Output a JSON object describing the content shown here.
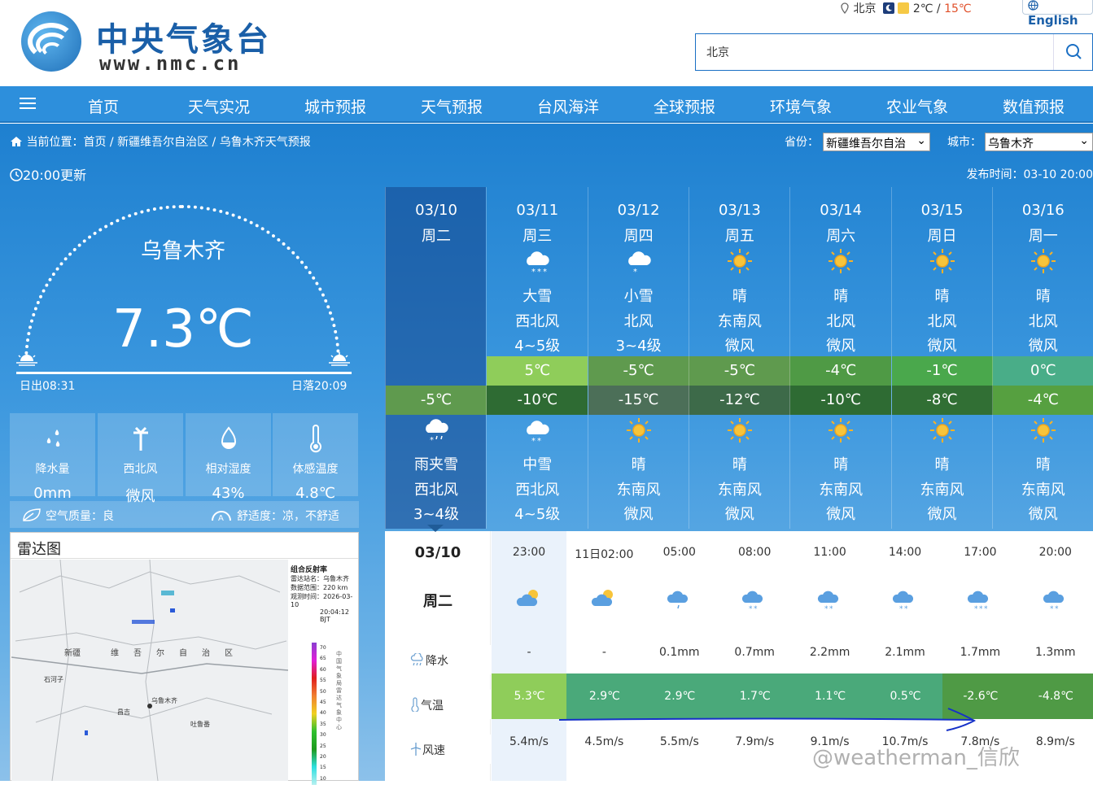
{
  "header": {
    "logo_cn": "中央气象台",
    "logo_en": "www.nmc.cn",
    "location": "北京",
    "temp_low": "2℃",
    "temp_sep": " / ",
    "temp_high": "15℃",
    "english_link": "English",
    "search_value": "北京"
  },
  "nav": [
    "首页",
    "天气实况",
    "城市预报",
    "天气预报",
    "台风海洋",
    "全球预报",
    "环境气象",
    "农业气象",
    "数值预报"
  ],
  "breadcrumb": {
    "prefix": "当前位置：",
    "home": "首页",
    "sep1": " / ",
    "region": "新疆维吾尔自治区",
    "sep2": " / ",
    "page": "乌鲁木齐天气预报"
  },
  "selectors": {
    "province_label": "省份：",
    "province_value": "新疆维吾尔自治",
    "city_label": "城市：",
    "city_value": "乌鲁木齐"
  },
  "update_text": "20:00更新",
  "publish_text": "发布时间：03-10 20:00",
  "current": {
    "city": "乌鲁木齐",
    "temperature": "7.3℃",
    "sunrise": "日出08:31",
    "sunset": "日落20:09",
    "stats": [
      {
        "label": "降水量",
        "value": "0mm",
        "icon": "raindrops-icon"
      },
      {
        "label": "西北风",
        "value": "微风",
        "icon": "windmill-icon"
      },
      {
        "label": "相对湿度",
        "value": "43%",
        "icon": "humidity-drop-icon"
      },
      {
        "label": "体感温度",
        "value": "4.8℃",
        "icon": "thermometer-icon"
      }
    ],
    "air_quality": "空气质量：良",
    "comfort": "舒适度：凉，不舒适"
  },
  "radar": {
    "title": "雷达图",
    "legend_title": "组合反射率",
    "station": "雷达站名：乌鲁木齐",
    "range": "数据范围：220 km",
    "time_label": "观测时间：2026-03-10",
    "time_value": "20:04:12 BJT",
    "vertical_text": "中国气象局雷达气象中心",
    "scale": [
      "70",
      "65",
      "60",
      "55",
      "50",
      "45",
      "40",
      "35",
      "30",
      "25",
      "20",
      "15",
      "10"
    ],
    "places": [
      "新疆",
      "维",
      "吾",
      "尔",
      "自",
      "治",
      "区",
      "乌鲁木齐",
      "昌吉",
      "吐鲁番",
      "石河子"
    ]
  },
  "week": [
    {
      "date": "03/10",
      "weekday": "周二",
      "day_weather": "",
      "day_wind_dir": "",
      "day_wind_force": "",
      "high": "",
      "low": "-5℃",
      "night_weather": "雨夹雪",
      "night_wind_dir": "西北风",
      "night_wind_force": "3~4级",
      "high_color": "",
      "low_color": "#5f9a4e"
    },
    {
      "date": "03/11",
      "weekday": "周三",
      "day_weather": "大雪",
      "day_wind_dir": "西北风",
      "day_wind_force": "4~5级",
      "high": "5℃",
      "low": "-10℃",
      "night_weather": "中雪",
      "night_wind_dir": "西北风",
      "night_wind_force": "4~5级",
      "high_color": "#8fcd5a",
      "low_color": "#2e6b33"
    },
    {
      "date": "03/12",
      "weekday": "周四",
      "day_weather": "小雪",
      "day_wind_dir": "北风",
      "day_wind_force": "3~4级",
      "high": "-5℃",
      "low": "-15℃",
      "night_weather": "晴",
      "night_wind_dir": "东南风",
      "night_wind_force": "微风",
      "high_color": "#5f9a4e",
      "low_color": "#4c6f58"
    },
    {
      "date": "03/13",
      "weekday": "周五",
      "day_weather": "晴",
      "day_wind_dir": "东南风",
      "day_wind_force": "微风",
      "high": "-5℃",
      "low": "-12℃",
      "night_weather": "晴",
      "night_wind_dir": "东南风",
      "night_wind_force": "微风",
      "high_color": "#5f9a4e",
      "low_color": "#3d6a49"
    },
    {
      "date": "03/14",
      "weekday": "周六",
      "day_weather": "晴",
      "day_wind_dir": "北风",
      "day_wind_force": "微风",
      "high": "-4℃",
      "low": "-10℃",
      "night_weather": "晴",
      "night_wind_dir": "东南风",
      "night_wind_force": "微风",
      "high_color": "#4f9a45",
      "low_color": "#2e6b33"
    },
    {
      "date": "03/15",
      "weekday": "周日",
      "day_weather": "晴",
      "day_wind_dir": "北风",
      "day_wind_force": "微风",
      "high": "-1℃",
      "low": "-8℃",
      "night_weather": "晴",
      "night_wind_dir": "东南风",
      "night_wind_force": "微风",
      "high_color": "#4aa84c",
      "low_color": "#316f34"
    },
    {
      "date": "03/16",
      "weekday": "周一",
      "day_weather": "晴",
      "day_wind_dir": "北风",
      "day_wind_force": "微风",
      "high": "0℃",
      "low": "-4℃",
      "night_weather": "晴",
      "night_wind_dir": "东南风",
      "night_wind_force": "微风",
      "high_color": "#49ad88",
      "low_color": "#56a040"
    }
  ],
  "hourly": {
    "date": "03/10",
    "weekday": "周二",
    "labels": {
      "precip": "降水",
      "temp": "气温",
      "wind": "风速"
    },
    "times": [
      "23:00",
      "11日02:00",
      "05:00",
      "08:00",
      "11:00",
      "14:00",
      "17:00",
      "20:00"
    ],
    "precip": [
      "-",
      "-",
      "0.1mm",
      "0.7mm",
      "2.2mm",
      "2.1mm",
      "1.7mm",
      "1.3mm"
    ],
    "temps": [
      "5.3℃",
      "2.9℃",
      "2.9℃",
      "1.7℃",
      "1.1℃",
      "0.5℃",
      "-2.6℃",
      "-4.8℃"
    ],
    "temp_colors": [
      "#8fcd5a",
      "#4aa97a",
      "#4aa97a",
      "#4aa97a",
      "#4aa97a",
      "#4aa97a",
      "#4f9a45",
      "#4f9a45"
    ],
    "winds": [
      "5.4m/s",
      "4.5m/s",
      "5.5m/s",
      "7.9m/s",
      "9.1m/s",
      "10.7m/s",
      "7.8m/s",
      "8.9m/s"
    ]
  },
  "watermark": "@weatherman_信欣"
}
